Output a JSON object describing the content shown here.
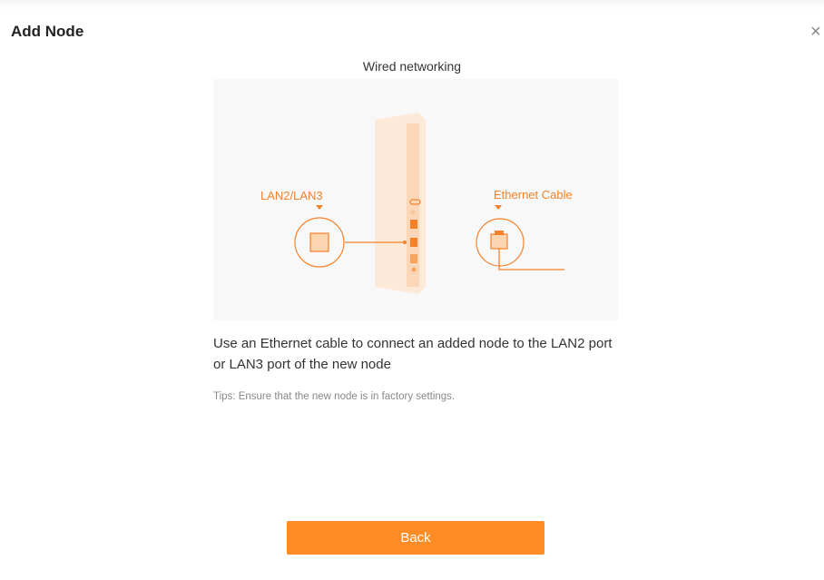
{
  "dialog": {
    "title": "Add Node",
    "close_glyph": "×",
    "close_icon": "close-icon"
  },
  "content": {
    "subtitle": "Wired networking",
    "illustration": {
      "lan_label": "LAN2/LAN3",
      "ethernet_label": "Ethernet Cable",
      "accent_color": "#f5822a"
    },
    "instruction": "Use an Ethernet cable to connect an added node to the LAN2 port or LAN3 port of the new node",
    "tips": "Tips: Ensure that the new node is in factory settings."
  },
  "footer": {
    "back_label": "Back",
    "back_color": "#ff8c25"
  }
}
